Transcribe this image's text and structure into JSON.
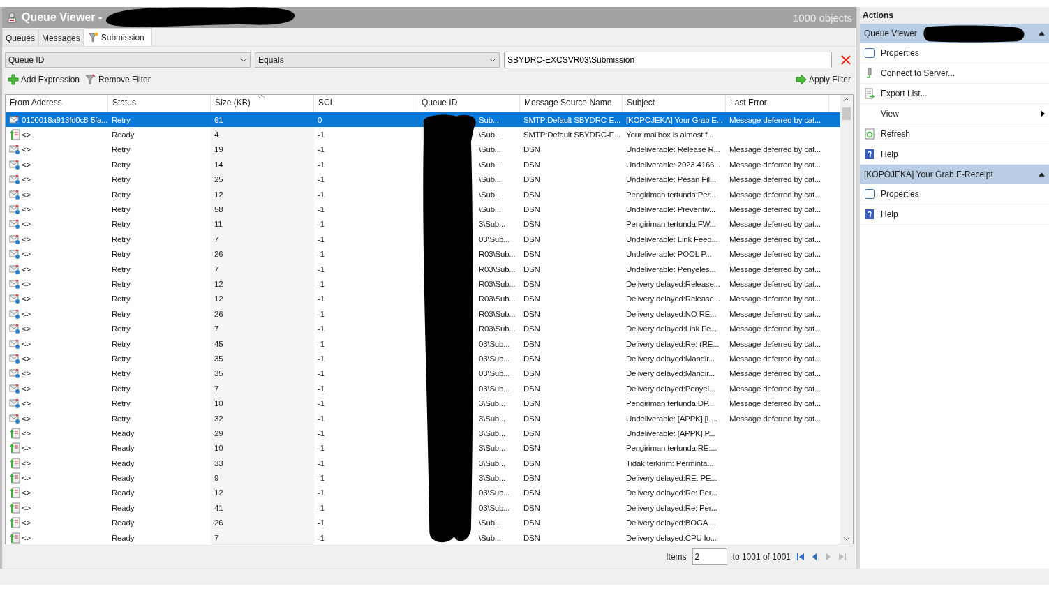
{
  "window": {
    "title": "Queue Viewer -",
    "object_count": "1000 objects"
  },
  "tabs": [
    {
      "label": "Queues",
      "selected": false,
      "kind": "plain"
    },
    {
      "label": "Messages",
      "selected": false,
      "kind": "plain"
    },
    {
      "label": "Submission",
      "selected": true,
      "kind": "filter"
    }
  ],
  "filter": {
    "field": "Queue ID",
    "operator": "Equals",
    "value": "SBYDRC-EXCSVR03\\Submission"
  },
  "toolbar": {
    "add": "Add Expression",
    "remove": "Remove Filter",
    "apply": "Apply Filter"
  },
  "table": {
    "columns": [
      {
        "label": "From Address",
        "sorted": false
      },
      {
        "label": "Status",
        "sorted": false
      },
      {
        "label": "Size (KB)",
        "sorted": true
      },
      {
        "label": "SCL",
        "sorted": false
      },
      {
        "label": "Queue ID",
        "sorted": false
      },
      {
        "label": "Message Source Name",
        "sorted": false
      },
      {
        "label": "Subject",
        "sorted": false
      },
      {
        "label": "Last Error",
        "sorted": false
      }
    ],
    "rows": [
      {
        "kind": "retry",
        "selected": true,
        "from": "0100018a913fd0c8-5fa...",
        "status": "Retry",
        "size": "61",
        "scl": "0",
        "queue": "Sub...",
        "source": "SMTP:Default SBYDRC-E...",
        "subject": "[KOPOJEKA] Your Grab E...",
        "error": "Message deferred by cat..."
      },
      {
        "kind": "ready",
        "selected": false,
        "from": "<>",
        "status": "Ready",
        "size": "4",
        "scl": "-1",
        "queue": "\\Sub...",
        "source": "SMTP:Default SBYDRC-E...",
        "subject": "Your mailbox is almost f...",
        "error": ""
      },
      {
        "kind": "retry",
        "selected": false,
        "from": "<>",
        "status": "Retry",
        "size": "19",
        "scl": "-1",
        "queue": "\\Sub...",
        "source": "DSN",
        "subject": "Undeliverable: Release R...",
        "error": "Message deferred by cat..."
      },
      {
        "kind": "retry",
        "selected": false,
        "from": "<>",
        "status": "Retry",
        "size": "14",
        "scl": "-1",
        "queue": "\\Sub...",
        "source": "DSN",
        "subject": "Undeliverable: 2023.4166...",
        "error": "Message deferred by cat..."
      },
      {
        "kind": "retry",
        "selected": false,
        "from": "<>",
        "status": "Retry",
        "size": "25",
        "scl": "-1",
        "queue": "\\Sub...",
        "source": "DSN",
        "subject": "Undeliverable: Pesan Fil...",
        "error": "Message deferred by cat..."
      },
      {
        "kind": "retry",
        "selected": false,
        "from": "<>",
        "status": "Retry",
        "size": "12",
        "scl": "-1",
        "queue": "\\Sub...",
        "source": "DSN",
        "subject": "Pengiriman tertunda:Per...",
        "error": "Message deferred by cat..."
      },
      {
        "kind": "retry",
        "selected": false,
        "from": "<>",
        "status": "Retry",
        "size": "58",
        "scl": "-1",
        "queue": "\\Sub...",
        "source": "DSN",
        "subject": "Undeliverable: Preventiv...",
        "error": "Message deferred by cat..."
      },
      {
        "kind": "retry",
        "selected": false,
        "from": "<>",
        "status": "Retry",
        "size": "11",
        "scl": "-1",
        "queue": "3\\Sub...",
        "source": "DSN",
        "subject": "Pengiriman tertunda:FW...",
        "error": "Message deferred by cat..."
      },
      {
        "kind": "retry",
        "selected": false,
        "from": "<>",
        "status": "Retry",
        "size": "7",
        "scl": "-1",
        "queue": "03\\Sub...",
        "source": "DSN",
        "subject": "Undeliverable: Link Feed...",
        "error": "Message deferred by cat..."
      },
      {
        "kind": "retry",
        "selected": false,
        "from": "<>",
        "status": "Retry",
        "size": "26",
        "scl": "-1",
        "queue": "R03\\Sub...",
        "source": "DSN",
        "subject": "Undeliverable: POOL   P...",
        "error": "Message deferred by cat..."
      },
      {
        "kind": "retry",
        "selected": false,
        "from": "<>",
        "status": "Retry",
        "size": "7",
        "scl": "-1",
        "queue": "R03\\Sub...",
        "source": "DSN",
        "subject": "Undeliverable: Penyeles...",
        "error": "Message deferred by cat..."
      },
      {
        "kind": "retry",
        "selected": false,
        "from": "<>",
        "status": "Retry",
        "size": "12",
        "scl": "-1",
        "queue": "R03\\Sub...",
        "source": "DSN",
        "subject": "Delivery delayed:Release...",
        "error": "Message deferred by cat..."
      },
      {
        "kind": "retry",
        "selected": false,
        "from": "<>",
        "status": "Retry",
        "size": "12",
        "scl": "-1",
        "queue": "R03\\Sub...",
        "source": "DSN",
        "subject": "Delivery delayed:Release...",
        "error": "Message deferred by cat..."
      },
      {
        "kind": "retry",
        "selected": false,
        "from": "<>",
        "status": "Retry",
        "size": "26",
        "scl": "-1",
        "queue": "R03\\Sub...",
        "source": "DSN",
        "subject": "Delivery delayed:NO RE...",
        "error": "Message deferred by cat..."
      },
      {
        "kind": "retry",
        "selected": false,
        "from": "<>",
        "status": "Retry",
        "size": "7",
        "scl": "-1",
        "queue": "R03\\Sub...",
        "source": "DSN",
        "subject": "Delivery delayed:Link Fe...",
        "error": "Message deferred by cat..."
      },
      {
        "kind": "retry",
        "selected": false,
        "from": "<>",
        "status": "Retry",
        "size": "45",
        "scl": "-1",
        "queue": "03\\Sub...",
        "source": "DSN",
        "subject": "Delivery delayed:Re: (RE...",
        "error": "Message deferred by cat..."
      },
      {
        "kind": "retry",
        "selected": false,
        "from": "<>",
        "status": "Retry",
        "size": "35",
        "scl": "-1",
        "queue": "03\\Sub...",
        "source": "DSN",
        "subject": "Delivery delayed:Mandir...",
        "error": "Message deferred by cat..."
      },
      {
        "kind": "retry",
        "selected": false,
        "from": "<>",
        "status": "Retry",
        "size": "35",
        "scl": "-1",
        "queue": "03\\Sub...",
        "source": "DSN",
        "subject": "Delivery delayed:Mandir...",
        "error": "Message deferred by cat..."
      },
      {
        "kind": "retry",
        "selected": false,
        "from": "<>",
        "status": "Retry",
        "size": "7",
        "scl": "-1",
        "queue": "03\\Sub...",
        "source": "DSN",
        "subject": "Delivery delayed:Penyel...",
        "error": "Message deferred by cat..."
      },
      {
        "kind": "retry",
        "selected": false,
        "from": "<>",
        "status": "Retry",
        "size": "10",
        "scl": "-1",
        "queue": "3\\Sub...",
        "source": "DSN",
        "subject": "Pengiriman tertunda:DP...",
        "error": "Message deferred by cat..."
      },
      {
        "kind": "retry",
        "selected": false,
        "from": "<>",
        "status": "Retry",
        "size": "32",
        "scl": "-1",
        "queue": "3\\Sub...",
        "source": "DSN",
        "subject": "Undeliverable: [APPK] [L...",
        "error": "Message deferred by cat..."
      },
      {
        "kind": "ready",
        "selected": false,
        "from": "<>",
        "status": "Ready",
        "size": "29",
        "scl": "-1",
        "queue": "3\\Sub...",
        "source": "DSN",
        "subject": "Undeliverable: [APPK] P...",
        "error": ""
      },
      {
        "kind": "ready",
        "selected": false,
        "from": "<>",
        "status": "Ready",
        "size": "10",
        "scl": "-1",
        "queue": "3\\Sub...",
        "source": "DSN",
        "subject": "Pengiriman tertunda:RE:...",
        "error": ""
      },
      {
        "kind": "ready",
        "selected": false,
        "from": "<>",
        "status": "Ready",
        "size": "33",
        "scl": "-1",
        "queue": "3\\Sub...",
        "source": "DSN",
        "subject": "Tidak terkirim: Perminta...",
        "error": ""
      },
      {
        "kind": "ready",
        "selected": false,
        "from": "<>",
        "status": "Ready",
        "size": "9",
        "scl": "-1",
        "queue": "3\\Sub...",
        "source": "DSN",
        "subject": "Delivery delayed:RE: PE...",
        "error": ""
      },
      {
        "kind": "ready",
        "selected": false,
        "from": "<>",
        "status": "Ready",
        "size": "12",
        "scl": "-1",
        "queue": "03\\Sub...",
        "source": "DSN",
        "subject": "Delivery delayed:Re: Per...",
        "error": ""
      },
      {
        "kind": "ready",
        "selected": false,
        "from": "<>",
        "status": "Ready",
        "size": "41",
        "scl": "-1",
        "queue": "03\\Sub...",
        "source": "DSN",
        "subject": "Delivery delayed:Re: Per...",
        "error": ""
      },
      {
        "kind": "ready",
        "selected": false,
        "from": "<>",
        "status": "Ready",
        "size": "26",
        "scl": "-1",
        "queue": "\\Sub...",
        "source": "DSN",
        "subject": "Delivery delayed:BOGA  ...",
        "error": ""
      },
      {
        "kind": "ready",
        "selected": false,
        "from": "<>",
        "status": "Ready",
        "size": "7",
        "scl": "-1",
        "queue": "\\Sub...",
        "source": "DSN",
        "subject": "Delivery delayed:CPU Io...",
        "error": ""
      }
    ]
  },
  "pager": {
    "label": "Items",
    "value": "2",
    "range": "to 1001 of 1001",
    "buttons": [
      {
        "kind": "first",
        "disabled": false
      },
      {
        "kind": "prev",
        "disabled": false
      },
      {
        "kind": "next",
        "disabled": true
      },
      {
        "kind": "last",
        "disabled": true
      }
    ]
  },
  "actions": {
    "title": "Actions",
    "groups": [
      {
        "title": "Queue Viewer",
        "items": [
          {
            "kind": "properties",
            "label": "Properties"
          },
          {
            "kind": "connect",
            "label": "Connect to Server..."
          },
          {
            "kind": "export",
            "label": "Export List..."
          },
          {
            "kind": "submenu",
            "label": "View"
          },
          {
            "kind": "refresh",
            "label": "Refresh"
          },
          {
            "kind": "help",
            "label": "Help"
          }
        ]
      },
      {
        "title": "[KOPOJEKA] Your Grab E-Receipt",
        "items": [
          {
            "kind": "properties",
            "label": "Properties"
          },
          {
            "kind": "help",
            "label": "Help"
          }
        ]
      }
    ]
  }
}
